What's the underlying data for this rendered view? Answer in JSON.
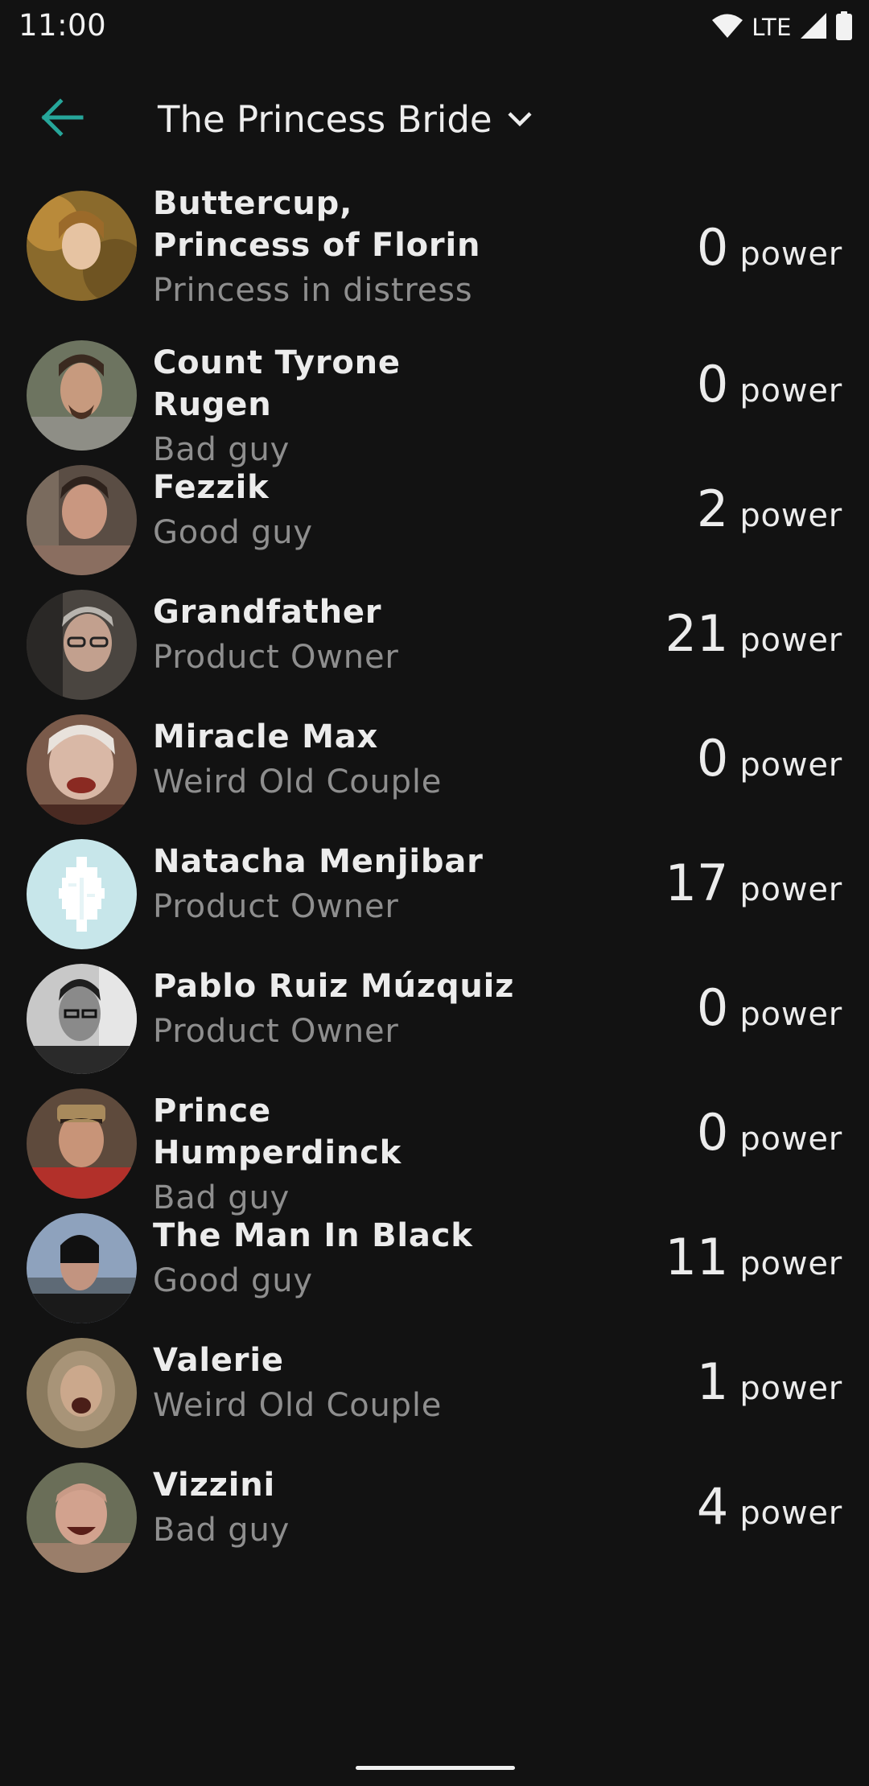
{
  "status_bar": {
    "time": "11:00",
    "network": "LTE",
    "icons": [
      "wifi-icon",
      "cell-signal-icon",
      "battery-icon"
    ]
  },
  "app_bar": {
    "back_icon": "arrow-back-icon",
    "title": "The Princess Bride",
    "dropdown_icon": "chevron-down-icon"
  },
  "colors": {
    "background": "#121212",
    "accent": "#26a69a",
    "primary_text": "#ececec",
    "secondary_text": "#8e8e8e"
  },
  "members": [
    {
      "name": "Buttercup, Princess of Florin",
      "role": "Princess in distress",
      "power": "0",
      "unit": "power",
      "avatar": "buttercup-avatar"
    },
    {
      "name": "Count Tyrone Rugen",
      "role": "Bad guy",
      "power": "0",
      "unit": "power",
      "avatar": "count-rugen-avatar"
    },
    {
      "name": "Fezzik",
      "role": "Good guy",
      "power": "2",
      "unit": "power",
      "avatar": "fezzik-avatar"
    },
    {
      "name": "Grandfather",
      "role": "Product Owner",
      "power": "21",
      "unit": "power",
      "avatar": "grandfather-avatar"
    },
    {
      "name": "Miracle Max",
      "role": "Weird Old Couple",
      "power": "0",
      "unit": "power",
      "avatar": "miracle-max-avatar"
    },
    {
      "name": "Natacha Menjibar",
      "role": "Product Owner",
      "power": "17",
      "unit": "power",
      "avatar": "default-leaf-avatar"
    },
    {
      "name": "Pablo Ruiz Múzquiz",
      "role": "Product Owner",
      "power": "0",
      "unit": "power",
      "avatar": "pablo-avatar"
    },
    {
      "name": "Prince Humperdinck",
      "role": "Bad guy",
      "power": "0",
      "unit": "power",
      "avatar": "humperdinck-avatar"
    },
    {
      "name": "The Man In Black",
      "role": "Good guy",
      "power": "11",
      "unit": "power",
      "avatar": "man-in-black-avatar"
    },
    {
      "name": "Valerie",
      "role": "Weird Old Couple",
      "power": "1",
      "unit": "power",
      "avatar": "valerie-avatar"
    },
    {
      "name": "Vizzini",
      "role": "Bad guy",
      "power": "4",
      "unit": "power",
      "avatar": "vizzini-avatar"
    }
  ]
}
